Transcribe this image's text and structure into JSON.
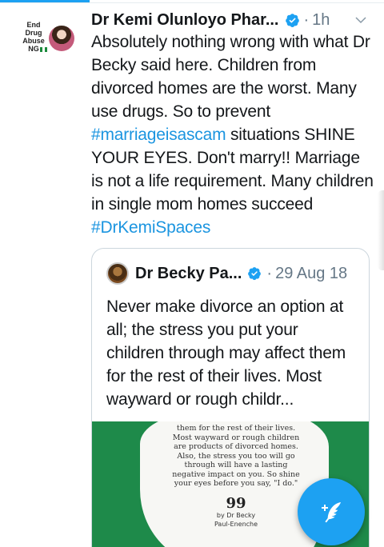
{
  "tweet": {
    "author_name": "Dr Kemi Olunloyo Phar...",
    "dot": "·",
    "time": "1h",
    "avatar_text": "End Drug Abuse NG",
    "text_segments": [
      {
        "text": "Absolutely nothing wrong with what Dr Becky said here. Children from divorced homes are the worst. Many use drugs. So to prevent ",
        "hashtag": false
      },
      {
        "text": "#marriageisascam",
        "hashtag": true
      },
      {
        "text": " situations SHINE YOUR EYES. Don't marry!! Marriage is not a life requirement. Many children in single mom homes succeed ",
        "hashtag": false
      },
      {
        "text": "#DrKemiSpaces",
        "hashtag": true
      }
    ]
  },
  "quoted_tweet": {
    "author_name": "Dr Becky Pa...",
    "dot": "·",
    "date": "29 Aug 18",
    "text": "Never make divorce an option at all; the stress you put your children through may affect them for the rest of their lives. Most wayward or rough childr...",
    "image": {
      "quote_text": "them for the rest of their lives. Most wayward or rough children are products of divorced homes. Also, the stress you too will go through will have a lasting negative impact on you. So shine your eyes before you say, \"I do.\"",
      "quote_marks": "99",
      "byline_line1": "by Dr Becky",
      "byline_line2": "Paul-Enenche",
      "background_color": "#1e8a4a"
    }
  },
  "icons": {
    "verified": "verified-badge-icon",
    "chevron": "chevron-down-icon",
    "compose": "compose-tweet-icon"
  },
  "colors": {
    "accent": "#1da1f2",
    "hashtag": "#1b95e0",
    "secondary_text": "#657786"
  }
}
